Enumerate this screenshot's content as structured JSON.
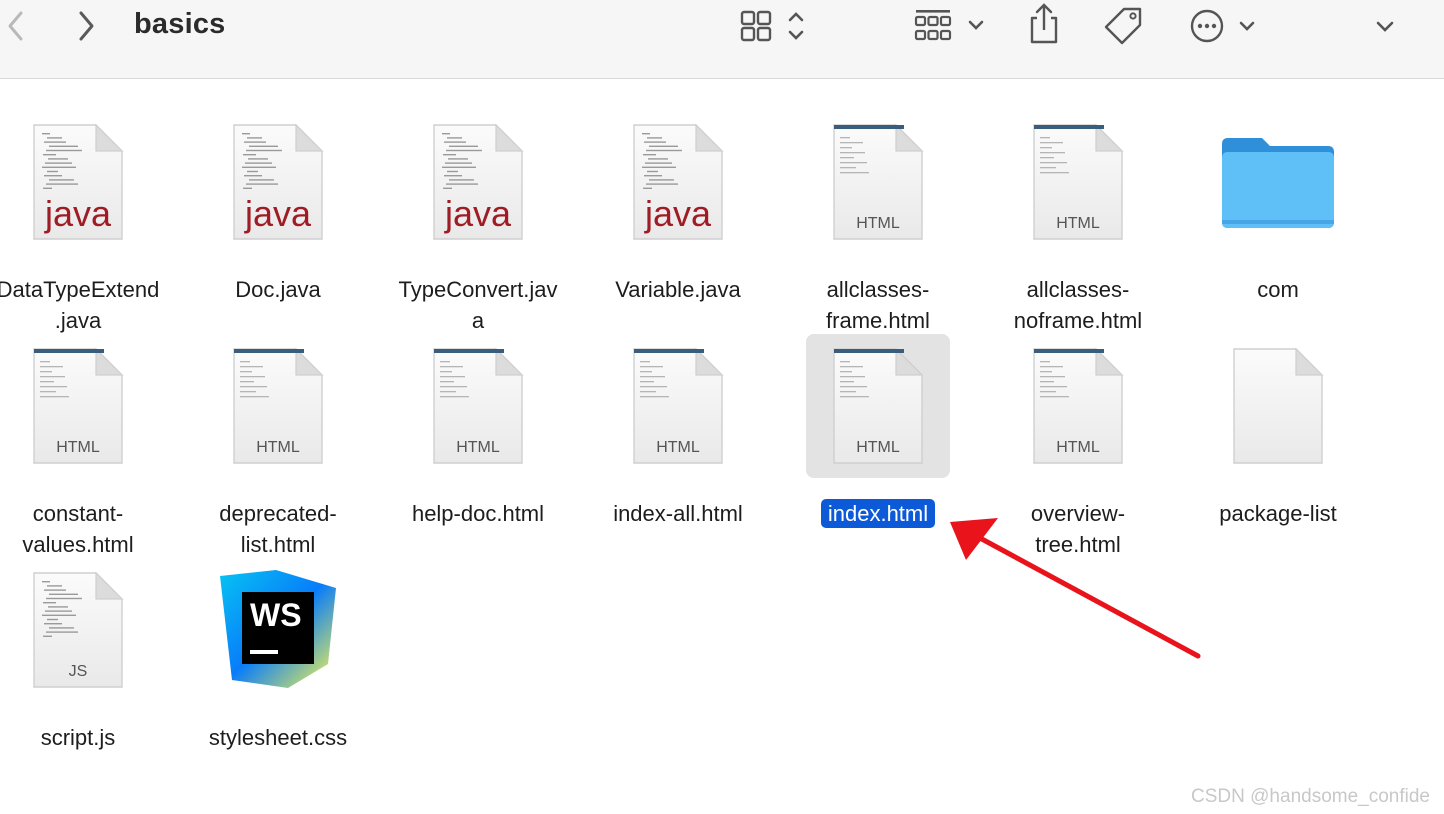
{
  "window": {
    "title": "basics",
    "toolbar": {
      "back_icon": "chevron-left-icon",
      "forward_icon": "chevron-right-icon",
      "view_icon": "grid-view-icon",
      "group_icon": "group-by-icon",
      "share_icon": "share-icon",
      "tag_icon": "tag-icon",
      "more_icon": "ellipsis-circle-icon",
      "expand_icon": "chevron-down-icon"
    }
  },
  "files": [
    {
      "name": "DataTypeExtend.java",
      "line1": "DataTypeExtend",
      "line2": ".java",
      "kind": "java",
      "ext": "java"
    },
    {
      "name": "Doc.java",
      "line1": "Doc.java",
      "line2": "",
      "kind": "java",
      "ext": "java"
    },
    {
      "name": "TypeConvert.java",
      "line1": "TypeConvert.jav",
      "line2": "a",
      "kind": "java",
      "ext": "java"
    },
    {
      "name": "Variable.java",
      "line1": "Variable.java",
      "line2": "",
      "kind": "java",
      "ext": "java"
    },
    {
      "name": "allclasses-frame.html",
      "line1": "allclasses-",
      "line2": "frame.html",
      "kind": "html",
      "ext": "HTML"
    },
    {
      "name": "allclasses-noframe.html",
      "line1": "allclasses-",
      "line2": "noframe.html",
      "kind": "html",
      "ext": "HTML"
    },
    {
      "name": "com",
      "line1": "com",
      "line2": "",
      "kind": "folder",
      "ext": ""
    },
    {
      "name": "constant-values.html",
      "line1": "constant-",
      "line2": "values.html",
      "kind": "html",
      "ext": "HTML"
    },
    {
      "name": "deprecated-list.html",
      "line1": "deprecated-",
      "line2": "list.html",
      "kind": "html",
      "ext": "HTML"
    },
    {
      "name": "help-doc.html",
      "line1": "help-doc.html",
      "line2": "",
      "kind": "html",
      "ext": "HTML"
    },
    {
      "name": "index-all.html",
      "line1": "index-all.html",
      "line2": "",
      "kind": "html",
      "ext": "HTML"
    },
    {
      "name": "index.html",
      "line1": "index.html",
      "line2": "",
      "kind": "html",
      "ext": "HTML",
      "selected": true
    },
    {
      "name": "overview-tree.html",
      "line1": "overview-",
      "line2": "tree.html",
      "kind": "html",
      "ext": "HTML"
    },
    {
      "name": "package-list",
      "line1": "package-list",
      "line2": "",
      "kind": "blank",
      "ext": ""
    },
    {
      "name": "script.js",
      "line1": "script.js",
      "line2": "",
      "kind": "js",
      "ext": "JS"
    },
    {
      "name": "stylesheet.css",
      "line1": "stylesheet.css",
      "line2": "",
      "kind": "webstorm",
      "ext": "WS"
    }
  ],
  "annotation": {
    "color": "#e8131b",
    "points_to": "index.html"
  },
  "watermark": "CSDN @handsome_confide",
  "colors": {
    "selection": "#0c5ad8",
    "java_text": "#a01c24",
    "folder": "#4fb3f0"
  }
}
